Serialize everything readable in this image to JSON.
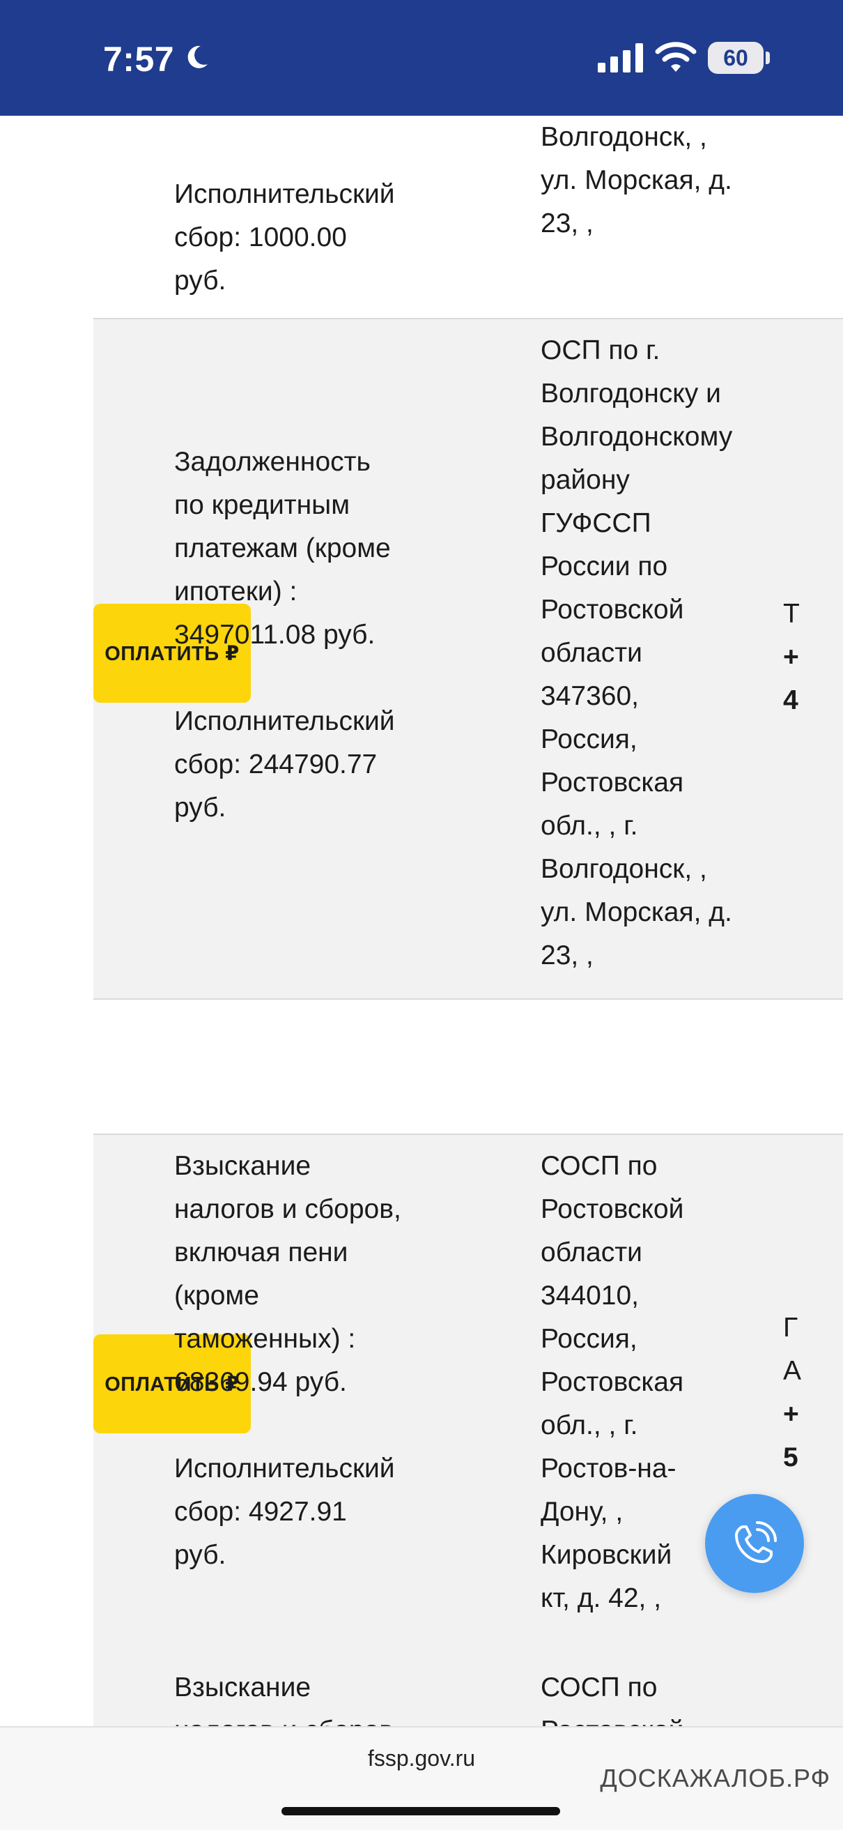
{
  "status_bar": {
    "time": "7:57",
    "battery": "60"
  },
  "row_top": {
    "subject_lines": [
      "Исполнительский",
      "сбор: 1000.00",
      "руб."
    ],
    "dept_lines": [
      "Волгодонск, ,",
      "ул. Морская, д.",
      "23, ,"
    ]
  },
  "row1": {
    "pay_label": "ОПЛАТИТЬ ₽",
    "subject_lines": [
      "Задолженность",
      "по кредитным",
      "платежам (кроме",
      "ипотеки) :",
      "3497011.08 руб."
    ],
    "fee_lines": [
      "Исполнительский",
      "сбор: 244790.77",
      "руб."
    ],
    "dept_lines": [
      "ОСП по г.",
      "Волгодонску и",
      "Волгодонскому",
      "району",
      "ГУФССП",
      "России по",
      "Ростовской",
      "области",
      "347360,",
      "Россия,",
      "Ростовская",
      "обл., , г.",
      "Волгодонск, ,",
      "ул. Морская, д.",
      "23, ,"
    ],
    "extra_lines": [
      "Т",
      "+",
      "4"
    ]
  },
  "row2": {
    "pay_label": "ОПЛАТИТЬ ₽",
    "subject_lines": [
      "Взыскание",
      "налогов и сборов,",
      "включая пени",
      "(кроме",
      "таможенных) :",
      "68369.94 руб."
    ],
    "fee_lines": [
      "Исполнительский",
      "сбор: 4927.91",
      "руб."
    ],
    "dept_lines": [
      "СОСП по",
      "Ростовской",
      "области",
      "344010,",
      "Россия,",
      "Ростовская",
      "обл., , г.",
      "Ростов-на-",
      "Дону, ,",
      "Кировский",
      "кт, д. 42, ,"
    ],
    "extra_lines": [
      "Г",
      "А",
      "+",
      "5"
    ]
  },
  "row3": {
    "subject_lines": [
      "Взыскание",
      "налогов и сборов,"
    ],
    "dept_lines": [
      "СОСП по",
      "Ростовской"
    ]
  },
  "browser": {
    "url": "fssp.gov.ru",
    "watermark": "ДОСКАЖАЛОБ.РФ"
  },
  "colors": {
    "header": "#1f3c8e",
    "pay_button": "#fdd50b",
    "call_button": "#4a9cf0",
    "row_shade": "#f2f2f2"
  },
  "icons": {
    "moon": "moon-icon",
    "signal": "cellular-signal-icon",
    "wifi": "wifi-icon",
    "call": "phone-call-icon"
  }
}
